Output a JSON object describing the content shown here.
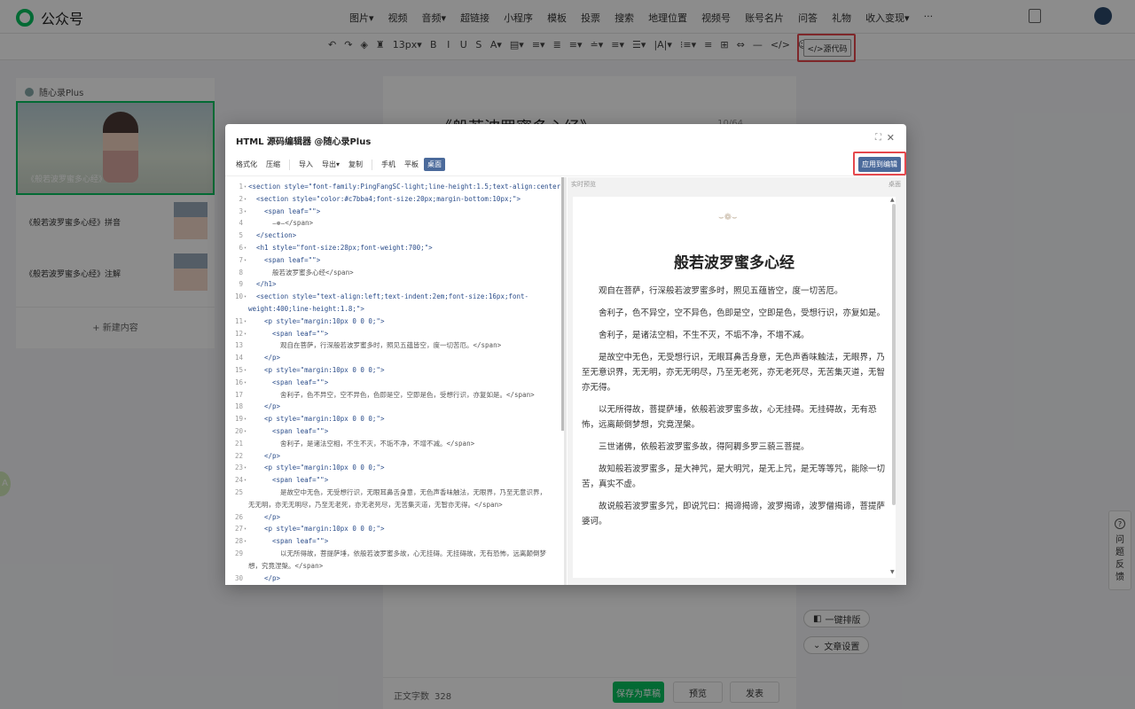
{
  "app": {
    "name": "公众号"
  },
  "top_menu": [
    "图片▾",
    "视频",
    "音频▾",
    "超链接",
    "小程序",
    "模板",
    "投票",
    "搜索",
    "地理位置",
    "视频号",
    "账号名片",
    "问答",
    "礼物",
    "收入变现▾",
    "···"
  ],
  "editor_toolbar": [
    "↶",
    "↷",
    "◈",
    "♜",
    "13px▾",
    "B",
    "I",
    "U",
    "S",
    "A▾",
    "▤▾",
    "≡▾",
    "≣",
    "≡▾",
    "≐▾",
    "≡▾",
    "☰▾",
    "|A|▾",
    "⁝≡▾",
    "≡",
    "⊞",
    "⇔",
    "—",
    "</>",
    "☺"
  ],
  "source_button": "</>源代码",
  "left_panel": {
    "header": "随心录Plus",
    "cover_caption": "《般若波罗蜜多心经》",
    "items": [
      "《般若波罗蜜多心经》拼音",
      "《般若波罗蜜多心经》注解"
    ],
    "new_content": "+ 新建内容"
  },
  "editor": {
    "title": "《般若波罗蜜多心经》",
    "title_count": "10/64"
  },
  "bottom_bar": {
    "word_count_label": "正文字数",
    "word_count": "328",
    "save": "保存为草稿",
    "preview": "预览",
    "publish": "发表"
  },
  "side": {
    "layout": "一键排版",
    "article_settings": "文章设置",
    "feedback": "问题反馈"
  },
  "help_dot": "A",
  "modal": {
    "title": "HTML 源码编辑器 @随心录Plus",
    "maximize": "⛶",
    "close": "✕",
    "toolbar": [
      {
        "label": "格式化",
        "active": false
      },
      {
        "label": "压缩",
        "active": false
      },
      {
        "sep": true
      },
      {
        "label": "导入",
        "active": false
      },
      {
        "label": "导出▾",
        "active": false
      },
      {
        "label": "复制",
        "active": false
      },
      {
        "sep": true
      },
      {
        "label": "手机",
        "active": false
      },
      {
        "label": "平板",
        "active": false
      },
      {
        "label": "桌面",
        "active": true
      }
    ],
    "apply": "应用到编辑",
    "preview_label": "实时预览",
    "preview_right": "桌面"
  },
  "code_lines": [
    {
      "n": "1",
      "fold": true,
      "indent": 0,
      "text": "<section style=\"font-family:PingFangSC-light;line-height:1.5;text-align:center;\">"
    },
    {
      "n": "2",
      "fold": true,
      "indent": 1,
      "text": "<section style=\"color:#c7bba4;font-size:20px;margin-bottom:10px;\">"
    },
    {
      "n": "3",
      "fold": true,
      "indent": 2,
      "text": "<span leaf=\"\">"
    },
    {
      "n": "4",
      "fold": false,
      "indent": 3,
      "text": "⌣❁⌣</span>",
      "sub": true
    },
    {
      "n": "5",
      "fold": false,
      "indent": 1,
      "text": "</section>"
    },
    {
      "n": "6",
      "fold": true,
      "indent": 1,
      "text": "<h1 style=\"font-size:28px;font-weight:700;\">"
    },
    {
      "n": "7",
      "fold": true,
      "indent": 2,
      "text": "<span leaf=\"\">"
    },
    {
      "n": "8",
      "fold": false,
      "indent": 3,
      "text": "般若波罗蜜多心经</span>",
      "sub": true
    },
    {
      "n": "9",
      "fold": false,
      "indent": 1,
      "text": "</h1>"
    },
    {
      "n": "10",
      "fold": true,
      "indent": 1,
      "text": "<section style=\"text-align:left;text-indent:2em;font-size:16px;font-"
    },
    {
      "n": "",
      "fold": false,
      "indent": 0,
      "text": "weight:400;line-height:1.8;\">"
    },
    {
      "n": "11",
      "fold": true,
      "indent": 2,
      "text": "<p style=\"margin:10px 0 0 0;\">"
    },
    {
      "n": "12",
      "fold": true,
      "indent": 3,
      "text": "<span leaf=\"\">"
    },
    {
      "n": "13",
      "fold": false,
      "indent": 4,
      "text": "观自在菩萨，行深般若波罗蜜多时，照见五蕴皆空，度一切苦厄。</span>",
      "sub": true
    },
    {
      "n": "14",
      "fold": false,
      "indent": 2,
      "text": "</p>"
    },
    {
      "n": "15",
      "fold": true,
      "indent": 2,
      "text": "<p style=\"margin:10px 0 0 0;\">"
    },
    {
      "n": "16",
      "fold": true,
      "indent": 3,
      "text": "<span leaf=\"\">"
    },
    {
      "n": "17",
      "fold": false,
      "indent": 4,
      "text": "舍利子，色不异空，空不异色，色即是空，空即是色，受想行识，亦复如是。</span>",
      "sub": true
    },
    {
      "n": "18",
      "fold": false,
      "indent": 2,
      "text": "</p>"
    },
    {
      "n": "19",
      "fold": true,
      "indent": 2,
      "text": "<p style=\"margin:10px 0 0 0;\">"
    },
    {
      "n": "20",
      "fold": true,
      "indent": 3,
      "text": "<span leaf=\"\">"
    },
    {
      "n": "21",
      "fold": false,
      "indent": 4,
      "text": "舍利子，是诸法空相，不生不灭，不垢不净，不增不减。</span>",
      "sub": true
    },
    {
      "n": "22",
      "fold": false,
      "indent": 2,
      "text": "</p>"
    },
    {
      "n": "23",
      "fold": true,
      "indent": 2,
      "text": "<p style=\"margin:10px 0 0 0;\">"
    },
    {
      "n": "24",
      "fold": true,
      "indent": 3,
      "text": "<span leaf=\"\">"
    },
    {
      "n": "25",
      "fold": false,
      "indent": 4,
      "text": "是故空中无色，无受想行识，无眼耳鼻舌身意，无色声香味触法，无眼界，乃至无意识界，",
      "sub": true
    },
    {
      "n": "",
      "fold": false,
      "indent": 0,
      "text": "无无明，亦无无明尽，乃至无老死，亦无老死尽，无苦集灭道，无智亦无得。</span>",
      "sub": true
    },
    {
      "n": "26",
      "fold": false,
      "indent": 2,
      "text": "</p>"
    },
    {
      "n": "27",
      "fold": true,
      "indent": 2,
      "text": "<p style=\"margin:10px 0 0 0;\">"
    },
    {
      "n": "28",
      "fold": true,
      "indent": 3,
      "text": "<span leaf=\"\">"
    },
    {
      "n": "29",
      "fold": false,
      "indent": 4,
      "text": "以无所得故，菩提萨埵，依般若波罗蜜多故，心无挂碍。无挂碍故，无有恐怖，远离颠倒梦",
      "sub": true
    },
    {
      "n": "",
      "fold": false,
      "indent": 0,
      "text": "想，究竟涅槃。</span>",
      "sub": true
    },
    {
      "n": "30",
      "fold": false,
      "indent": 2,
      "text": "</p>"
    }
  ],
  "preview": {
    "ornament": "⌣❁⌣",
    "title": "般若波罗蜜多心经",
    "paragraphs": [
      "观自在菩萨，行深般若波罗蜜多时，照见五蕴皆空，度一切苦厄。",
      "舍利子，色不异空，空不异色，色即是空，空即是色，受想行识，亦复如是。",
      "舍利子，是诸法空相，不生不灭，不垢不净，不增不减。",
      "是故空中无色，无受想行识，无眼耳鼻舌身意，无色声香味触法，无眼界，乃至无意识界，无无明，亦无无明尽，乃至无老死，亦无老死尽，无苦集灭道，无智亦无得。",
      "以无所得故，菩提萨埵，依般若波罗蜜多故，心无挂碍。无挂碍故，无有恐怖，远离颠倒梦想，究竟涅槃。",
      "三世诸佛，依般若波罗蜜多故，得阿耨多罗三藐三菩提。",
      "故知般若波罗蜜多，是大神咒，是大明咒，是无上咒，是无等等咒，能除一切苦，真实不虚。",
      "故说般若波罗蜜多咒，即说咒曰：揭谛揭谛，波罗揭谛，波罗僧揭谛，菩提萨婆诃。"
    ]
  },
  "colors": {
    "brand_green": "#07c160",
    "highlight_red": "#e5484d",
    "modal_accent": "#4b6a9b",
    "code_text": "#2b4d8a"
  }
}
